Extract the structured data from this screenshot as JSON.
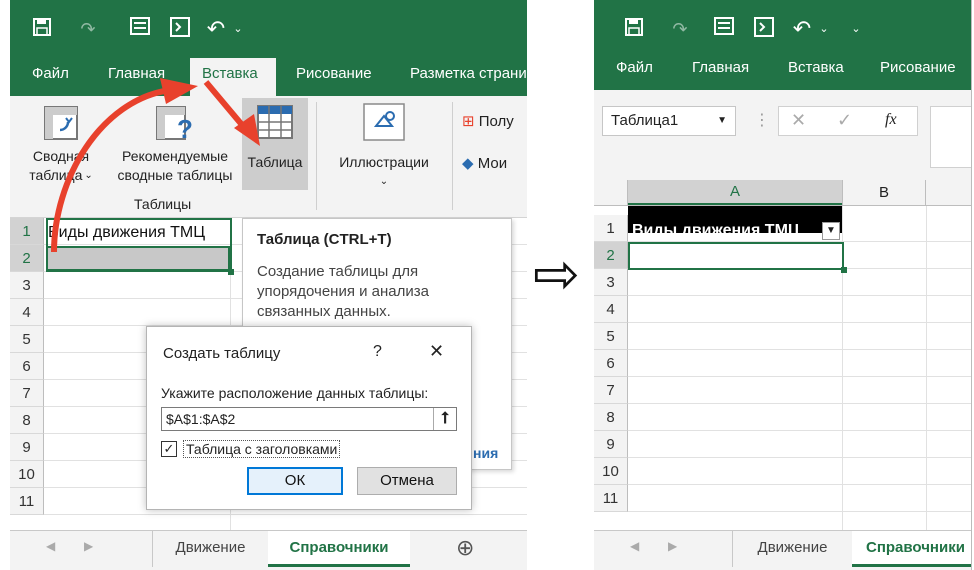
{
  "colors": {
    "excel_green": "#217346",
    "arrow_red": "#e8412c",
    "selection_green": "#217346",
    "table_header_bg": "#000000",
    "link_blue": "#2b6cb0"
  },
  "left": {
    "qat_icons": [
      "save-icon",
      "redo-icon",
      "form-icon",
      "macro-icon",
      "undo-icon",
      "dropdown-icon"
    ],
    "tabs": [
      "Файл",
      "Главная",
      "Вставка",
      "Рисование",
      "Разметка страни"
    ],
    "ribbon": {
      "pivot_label_1": "Сводная",
      "pivot_label_2": "таблица",
      "rec_pivot_label_1": "Рекомендуемые",
      "rec_pivot_label_2": "сводные таблицы",
      "table_label": "Таблица",
      "illustrations_label": "Иллюстрации",
      "group_label": "Таблицы",
      "addins_1": "Полу",
      "addins_2": "Мои"
    },
    "rows": [
      "1",
      "2",
      "3",
      "4",
      "5",
      "6",
      "7",
      "8",
      "9",
      "10",
      "11"
    ],
    "cell_a1": "Виды движения ТМЦ",
    "tooltip": {
      "title": "Таблица (CTRL+T)",
      "body_1": "Создание таблицы для",
      "body_2": "упорядочения и анализа",
      "body_3": "связанных данных.",
      "link_tail": "ния"
    },
    "dialog": {
      "title": "Создать таблицу",
      "help": "?",
      "close": "✕",
      "prompt": "Укажите расположение данных таблицы:",
      "range_value": "$A$1:$A$2",
      "checkbox_label": "Таблица с заголовками",
      "checkbox_checked": true,
      "ok": "ОК",
      "cancel": "Отмена"
    },
    "sheet_tabs": [
      "Движение",
      "Справочники"
    ],
    "active_sheet": "Справочники",
    "add_sheet": "⊕"
  },
  "right": {
    "qat_icons": [
      "save-icon",
      "redo-icon",
      "form-icon",
      "macro-icon",
      "undo-icon",
      "dropdown-icon"
    ],
    "tabs": [
      "Файл",
      "Главная",
      "Вставка",
      "Рисование"
    ],
    "name_box": "Таблица1",
    "name_box_arrow": "▼",
    "fx_cancel": "✕",
    "fx_confirm": "✓",
    "fx_label": "fx",
    "columns": [
      "A",
      "B"
    ],
    "rows": [
      "1",
      "2",
      "3",
      "4",
      "5",
      "6",
      "7",
      "8",
      "9",
      "10",
      "11"
    ],
    "cell_a1": "Виды движения ТМЦ",
    "filter_arrow": "▼",
    "sheet_tabs": [
      "Движение",
      "Справочники"
    ],
    "active_sheet": "Справочники"
  },
  "transition_arrow": "⇨"
}
